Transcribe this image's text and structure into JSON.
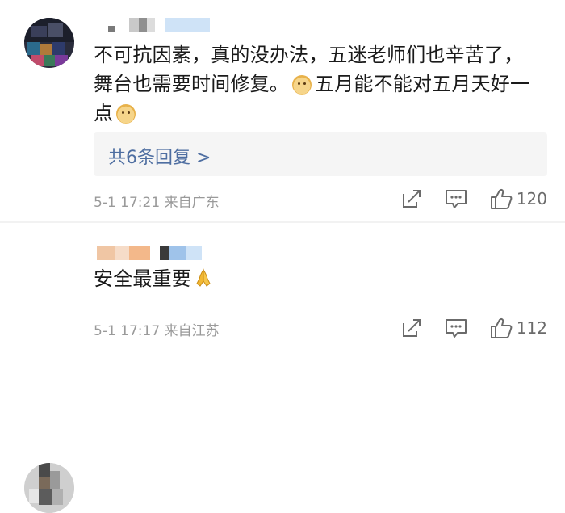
{
  "comments": [
    {
      "text_lines": [
        "不可抗因素，真的没办法，五迷老师们也辛苦了，",
        "舞台也需要时间修复。",
        "五月能不能对五月天好一",
        "点"
      ],
      "replies_label": "共6条回复 >",
      "time": "5-1 17:21",
      "location": "来自广东",
      "likes": "120"
    },
    {
      "text": "安全最重要",
      "time": "5-1 17:17",
      "location": "来自江苏",
      "likes": "112"
    }
  ],
  "icons": {
    "repost": "repost-icon",
    "comment": "comment-icon",
    "like": "like-icon",
    "emoji_dog": "dog-emoji-icon",
    "emoji_pray": "praying-hands-emoji-icon"
  },
  "colors": {
    "link": "#4e6ea1",
    "meta": "#9a9a9a",
    "reply_bg": "#f5f5f5"
  }
}
